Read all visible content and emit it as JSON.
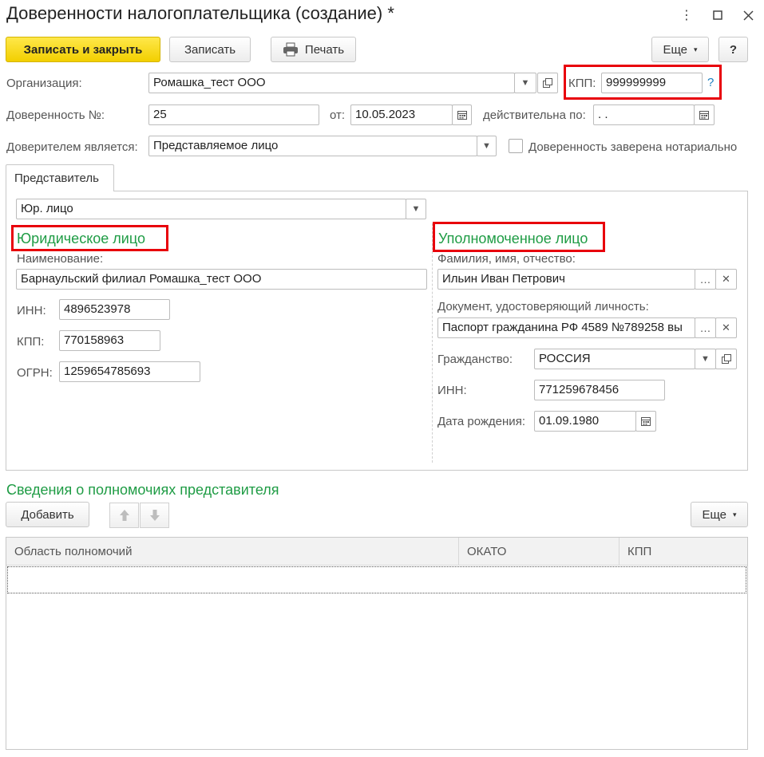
{
  "window": {
    "title": "Доверенности налогоплательщика (создание) *"
  },
  "toolbar": {
    "save_close_label": "Записать и закрыть",
    "save_label": "Записать",
    "print_label": "Печать",
    "more_label": "Еще",
    "help_label": "?"
  },
  "header": {
    "org_label": "Организация:",
    "org_value": "Ромашка_тест ООО",
    "kpp_label": "КПП:",
    "kpp_value": "999999999",
    "kpp_help": "?",
    "number_label": "Доверенность №:",
    "number_value": "25",
    "from_label": "от:",
    "from_value": "10.05.2023",
    "valid_label": "действительна по:",
    "valid_value": " .  .",
    "principal_label": "Доверителем является:",
    "principal_value": "Представляемое лицо",
    "notary_label": "Доверенность заверена нотариально"
  },
  "tabs": [
    {
      "label": "Представитель"
    }
  ],
  "representative": {
    "type_value": "Юр. лицо",
    "legal": {
      "heading": "Юридическое лицо",
      "name_label": "Наименование:",
      "name_value": "Барнаульский филиал Ромашка_тест ООО",
      "inn_label": "ИНН:",
      "inn_value": "4896523978",
      "kpp_label": "КПП:",
      "kpp_value": "770158963",
      "ogrn_label": "ОГРН:",
      "ogrn_value": "1259654785693"
    },
    "authorized": {
      "heading": "Уполномоченное лицо",
      "fio_label": "Фамилия, имя, отчество:",
      "fio_value": "Ильин Иван Петрович",
      "doc_label": "Документ, удостоверяющий личность:",
      "doc_value": "Паспорт гражданина РФ 4589 №789258 вы",
      "citizenship_label": "Гражданство:",
      "citizenship_value": "РОССИЯ",
      "inn_label": "ИНН:",
      "inn_value": "771259678456",
      "birth_label": "Дата рождения:",
      "birth_value": "01.09.1980"
    }
  },
  "powers": {
    "heading": "Сведения о полномочиях представителя",
    "add_label": "Добавить",
    "more_label": "Еще",
    "columns": [
      "Область полномочий",
      "ОКАТО",
      "КПП"
    ],
    "rows": []
  },
  "icons": {
    "kebab": "more-vertical-icon",
    "maximize": "maximize-icon",
    "close": "close-icon",
    "printer": "printer-icon",
    "calendar": "calendar-icon",
    "open": "open-form-icon",
    "clear": "clear-icon",
    "dropdown": "chevron-down-icon",
    "up": "arrow-up-icon",
    "down": "arrow-down-icon"
  },
  "colors": {
    "primary_button": "#f2cf00",
    "section_heading": "#1f9c45",
    "highlight": "#e8000b",
    "help_link": "#1a7fc1"
  }
}
